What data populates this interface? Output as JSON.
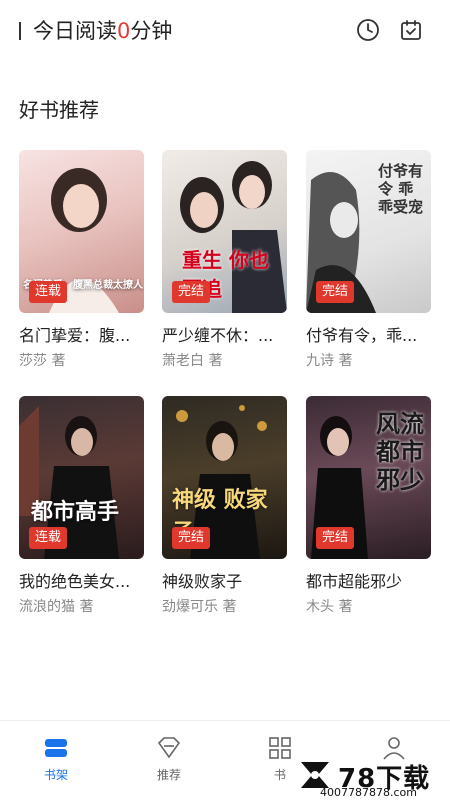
{
  "header": {
    "reading_prefix": "今日阅读",
    "reading_minutes": "0",
    "reading_suffix": "分钟",
    "icons": [
      "clock-icon",
      "calendar-check-icon"
    ]
  },
  "section": {
    "title": "好书推荐"
  },
  "books": [
    {
      "title": "名门挚爱：腹...",
      "author": "莎莎 著",
      "status": "连载",
      "cover_text": "名门挚爱：腹黑总裁太撩人"
    },
    {
      "title": "严少缠不休：...",
      "author": "萧老白 著",
      "status": "完结",
      "cover_text": "重生 你也要追"
    },
    {
      "title": "付爷有令，乖...",
      "author": "九诗 著",
      "status": "完结",
      "cover_text": "付爷有令 乖乖受宠"
    },
    {
      "title": "我的绝色美女...",
      "author": "流浪的猫 著",
      "status": "连载",
      "cover_text": "都市高手"
    },
    {
      "title": "神级败家子",
      "author": "劲爆可乐 著",
      "status": "完结",
      "cover_text": "神级 败家子"
    },
    {
      "title": "都市超能邪少",
      "author": "木头 著",
      "status": "完结",
      "cover_text": "风流都市邪少"
    }
  ],
  "tabs": [
    {
      "label": "书架",
      "icon": "bookshelf-icon",
      "active": true
    },
    {
      "label": "推荐",
      "icon": "diamond-icon",
      "active": false
    },
    {
      "label": "书",
      "icon": "grid-icon",
      "active": false
    },
    {
      "label": "",
      "icon": "person-icon",
      "active": false
    }
  ],
  "watermark": {
    "brand": "78下载",
    "url": "4007787878.com"
  },
  "colors": {
    "accent": "#1a73e8",
    "badge": "#e0382d",
    "highlight": "#e53935"
  }
}
